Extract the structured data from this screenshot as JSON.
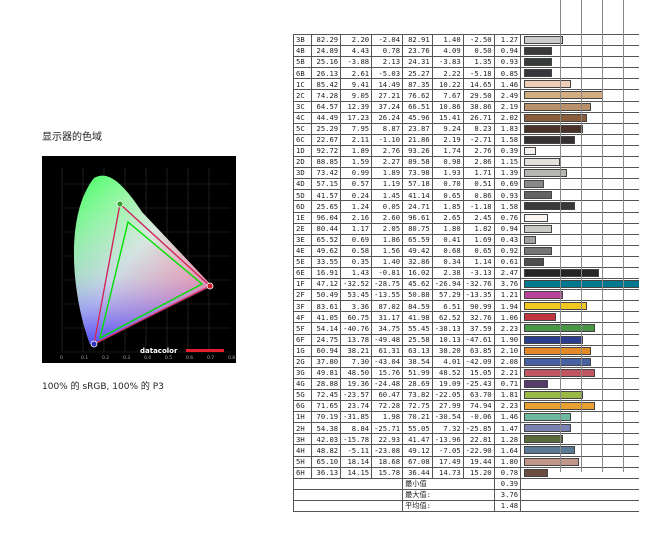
{
  "gamut": {
    "title": "显示器的色域",
    "caption": "100% 的 sRGB, 100% 的 P3",
    "brand": "datacolor",
    "axis_x_ticks": [
      "0",
      "0.1",
      "0.2",
      "0.3",
      "0.4",
      "0.5",
      "0.6",
      "0.7",
      "0.8"
    ],
    "colors": {
      "srgb_line": "#00e000",
      "p3_line": "#e02040",
      "display_line": "#5060ff",
      "brand_bar": "#e41e2f"
    }
  },
  "table": {
    "rows": [
      {
        "id": "3B",
        "v": [
          "82.29",
          "2.20",
          "-2.04",
          "82.91",
          "1.40",
          "-2.50"
        ],
        "de": "1.27",
        "color": "#cccccc",
        "len": 0.1
      },
      {
        "id": "4B",
        "v": [
          "24.89",
          "4.43",
          "0.78",
          "23.76",
          "4.09",
          "0.50"
        ],
        "de": "0.94",
        "color": "#3a3a3a",
        "len": 0.07
      },
      {
        "id": "5B",
        "v": [
          "25.16",
          "-3.88",
          "2.13",
          "24.31",
          "-3.83",
          "1.35"
        ],
        "de": "0.93",
        "color": "#383c38",
        "len": 0.07
      },
      {
        "id": "6B",
        "v": [
          "26.13",
          "2.61",
          "-5.03",
          "25.27",
          "2.22",
          "-5.18",
          "0.85"
        ],
        "de": "0.85",
        "color": "#36363c",
        "len": 0.07
      },
      {
        "id": "1C",
        "v": [
          "85.42",
          "9.41",
          "14.49",
          "87.35",
          "10.22",
          "14.65"
        ],
        "de": "1.46",
        "color": "#f0cdb8",
        "len": 0.12
      },
      {
        "id": "2C",
        "v": [
          "74.28",
          "9.05",
          "27.21",
          "76.62",
          "7.67",
          "29.50"
        ],
        "de": "2.49",
        "color": "#d2ad80",
        "len": 0.2
      },
      {
        "id": "3C",
        "v": [
          "64.57",
          "12.39",
          "37.24",
          "66.51",
          "10.86",
          "38.86"
        ],
        "de": "2.19",
        "color": "#b8906a",
        "len": 0.17
      },
      {
        "id": "4C",
        "v": [
          "44.49",
          "17.23",
          "26.24",
          "45.96",
          "15.41",
          "26.71"
        ],
        "de": "2.02",
        "color": "#8a5c3c",
        "len": 0.16
      },
      {
        "id": "5C",
        "v": [
          "25.29",
          "7.95",
          "8.87",
          "23.87",
          "9.24",
          "8.23"
        ],
        "de": "1.83",
        "color": "#4a3228",
        "len": 0.15
      },
      {
        "id": "6C",
        "v": [
          "22.67",
          "2.11",
          "-1.10",
          "21.86",
          "2.19",
          "-2.71"
        ],
        "de": "1.58",
        "color": "#343034",
        "len": 0.13
      },
      {
        "id": "1D",
        "v": [
          "92.72",
          "1.89",
          "2.76",
          "93.26",
          "1.74",
          "2.76"
        ],
        "de": "0.39",
        "color": "#f4f0ee",
        "len": 0.03
      },
      {
        "id": "2D",
        "v": [
          "88.85",
          "1.59",
          "2.27",
          "89.58",
          "0.98",
          "2.86"
        ],
        "de": "1.15",
        "color": "#e4e0dc",
        "len": 0.09
      },
      {
        "id": "3D",
        "v": [
          "73.42",
          "0.99",
          "1.89",
          "73.98",
          "1.93",
          "1.71"
        ],
        "de": "1.39",
        "color": "#b8b6b2",
        "len": 0.11
      },
      {
        "id": "4D",
        "v": [
          "57.15",
          "0.57",
          "1.19",
          "57.18",
          "0.70",
          "0.51"
        ],
        "de": "0.69",
        "color": "#8a8a88",
        "len": 0.05
      },
      {
        "id": "5D",
        "v": [
          "41.57",
          "0.24",
          "1.45",
          "41.14",
          "0.65",
          "0.86"
        ],
        "de": "0.93",
        "color": "#626260",
        "len": 0.07
      },
      {
        "id": "6D",
        "v": [
          "25.65",
          "1.24",
          "0.05",
          "24.71",
          "1.85",
          "-1.18"
        ],
        "de": "1.58",
        "color": "#3a3838",
        "len": 0.13
      },
      {
        "id": "1E",
        "v": [
          "96.04",
          "2.16",
          "2.60",
          "96.61",
          "2.65",
          "2.45"
        ],
        "de": "0.76",
        "color": "#fcf6f2",
        "len": 0.06
      },
      {
        "id": "2E",
        "v": [
          "80.44",
          "1.17",
          "2.05",
          "80.75",
          "1.80",
          "1.82"
        ],
        "de": "0.94",
        "color": "#cccac6",
        "len": 0.07
      },
      {
        "id": "3E",
        "v": [
          "65.52",
          "0.69",
          "1.86",
          "65.59",
          "0.41",
          "1.69"
        ],
        "de": "0.43",
        "color": "#a2a09c",
        "len": 0.03
      },
      {
        "id": "4E",
        "v": [
          "49.62",
          "0.58",
          "1.56",
          "49.42",
          "0.68",
          "0.65"
        ],
        "de": "0.92",
        "color": "#767472",
        "len": 0.07
      },
      {
        "id": "5E",
        "v": [
          "33.55",
          "0.35",
          "1.40",
          "32.86",
          "0.34",
          "1.14"
        ],
        "de": "0.61",
        "color": "#504e4c",
        "len": 0.05
      },
      {
        "id": "6E",
        "v": [
          "16.91",
          "1.43",
          "-0.81",
          "16.02",
          "2.38",
          "-3.13"
        ],
        "de": "2.47",
        "color": "#262426",
        "len": 0.19
      },
      {
        "id": "1F",
        "v": [
          "47.12",
          "-32.52",
          "-28.75",
          "45.62",
          "-26.94",
          "-32.76"
        ],
        "de": "3.76",
        "color": "#00788e",
        "len": 0.3
      },
      {
        "id": "2F",
        "v": [
          "50.49",
          "53.45",
          "-13.55",
          "50.88",
          "57.29",
          "-13.35"
        ],
        "de": "1.21",
        "color": "#b8449a",
        "len": 0.1
      },
      {
        "id": "3F",
        "v": [
          "83.61",
          "3.36",
          "87.02",
          "84.59",
          "6.51",
          "90.99"
        ],
        "de": "1.94",
        "color": "#f0c820",
        "len": 0.16
      },
      {
        "id": "4F",
        "v": [
          "41.05",
          "60.75",
          "31.17",
          "41.98",
          "62.52",
          "32.76"
        ],
        "de": "1.06",
        "color": "#c03440",
        "len": 0.08
      },
      {
        "id": "5F",
        "v": [
          "54.14",
          "-40.76",
          "34.75",
          "55.45",
          "-38.13",
          "37.59"
        ],
        "de": "2.23",
        "color": "#4a9644",
        "len": 0.18
      },
      {
        "id": "6F",
        "v": [
          "24.75",
          "13.78",
          "-49.48",
          "25.58",
          "10.13",
          "-47.61"
        ],
        "de": "1.90",
        "color": "#2a3c8e",
        "len": 0.15
      },
      {
        "id": "1G",
        "v": [
          "60.94",
          "38.21",
          "61.31",
          "63.13",
          "38.20",
          "63.85"
        ],
        "de": "2.10",
        "color": "#e28a28",
        "len": 0.17
      },
      {
        "id": "2G",
        "v": [
          "37.80",
          "7.30",
          "-43.04",
          "38.54",
          "4.01",
          "-42.09"
        ],
        "de": "2.08",
        "color": "#4860a4",
        "len": 0.17
      },
      {
        "id": "3G",
        "v": [
          "49.81",
          "48.50",
          "15.76",
          "51.99",
          "48.52",
          "15.05"
        ],
        "de": "2.21",
        "color": "#c05662",
        "len": 0.18
      },
      {
        "id": "4G",
        "v": [
          "28.88",
          "19.36",
          "-24.48",
          "28.69",
          "19.09",
          "-25.43"
        ],
        "de": "0.71",
        "color": "#5a3c6c",
        "len": 0.06
      },
      {
        "id": "5G",
        "v": [
          "72.45",
          "-23.57",
          "60.47",
          "73.82",
          "-22.05",
          "63.70"
        ],
        "de": "1.81",
        "color": "#9ab846",
        "len": 0.15
      },
      {
        "id": "6G",
        "v": [
          "71.65",
          "23.74",
          "72.28",
          "72.75",
          "27.99",
          "74.94"
        ],
        "de": "2.23",
        "color": "#e8a030",
        "len": 0.18
      },
      {
        "id": "1H",
        "v": [
          "70.19",
          "-31.85",
          "1.98",
          "70.21",
          "-30.54",
          "-0.06"
        ],
        "de": "1.46",
        "color": "#6cb8a0",
        "len": 0.12
      },
      {
        "id": "2H",
        "v": [
          "54.38",
          "8.84",
          "-25.71",
          "55.05",
          "7.32",
          "-25.85"
        ],
        "de": "1.47",
        "color": "#7a82b4",
        "len": 0.12
      },
      {
        "id": "3H",
        "v": [
          "42.03",
          "-15.78",
          "22.93",
          "41.47",
          "-13.96",
          "22.81"
        ],
        "de": "1.28",
        "color": "#5a6a3c",
        "len": 0.1
      },
      {
        "id": "4H",
        "v": [
          "48.82",
          "-5.11",
          "-23.08",
          "49.12",
          "-7.05",
          "-22.90"
        ],
        "de": "1.64",
        "color": "#5a7a98",
        "len": 0.13
      },
      {
        "id": "5H",
        "v": [
          "65.10",
          "18.14",
          "18.68",
          "67.08",
          "17.49",
          "19.44"
        ],
        "de": "1.80",
        "color": "#c2968a",
        "len": 0.14
      },
      {
        "id": "6H",
        "v": [
          "36.13",
          "14.15",
          "15.78",
          "36.44",
          "14.73",
          "15.20"
        ],
        "de": "0.78",
        "color": "#6a4c40",
        "len": 0.06
      }
    ],
    "summary": [
      {
        "label": "最小值",
        "value": "0.39"
      },
      {
        "label": "最大值:",
        "value": "3.76"
      },
      {
        "label": "平均值:",
        "value": "1.48"
      }
    ]
  }
}
